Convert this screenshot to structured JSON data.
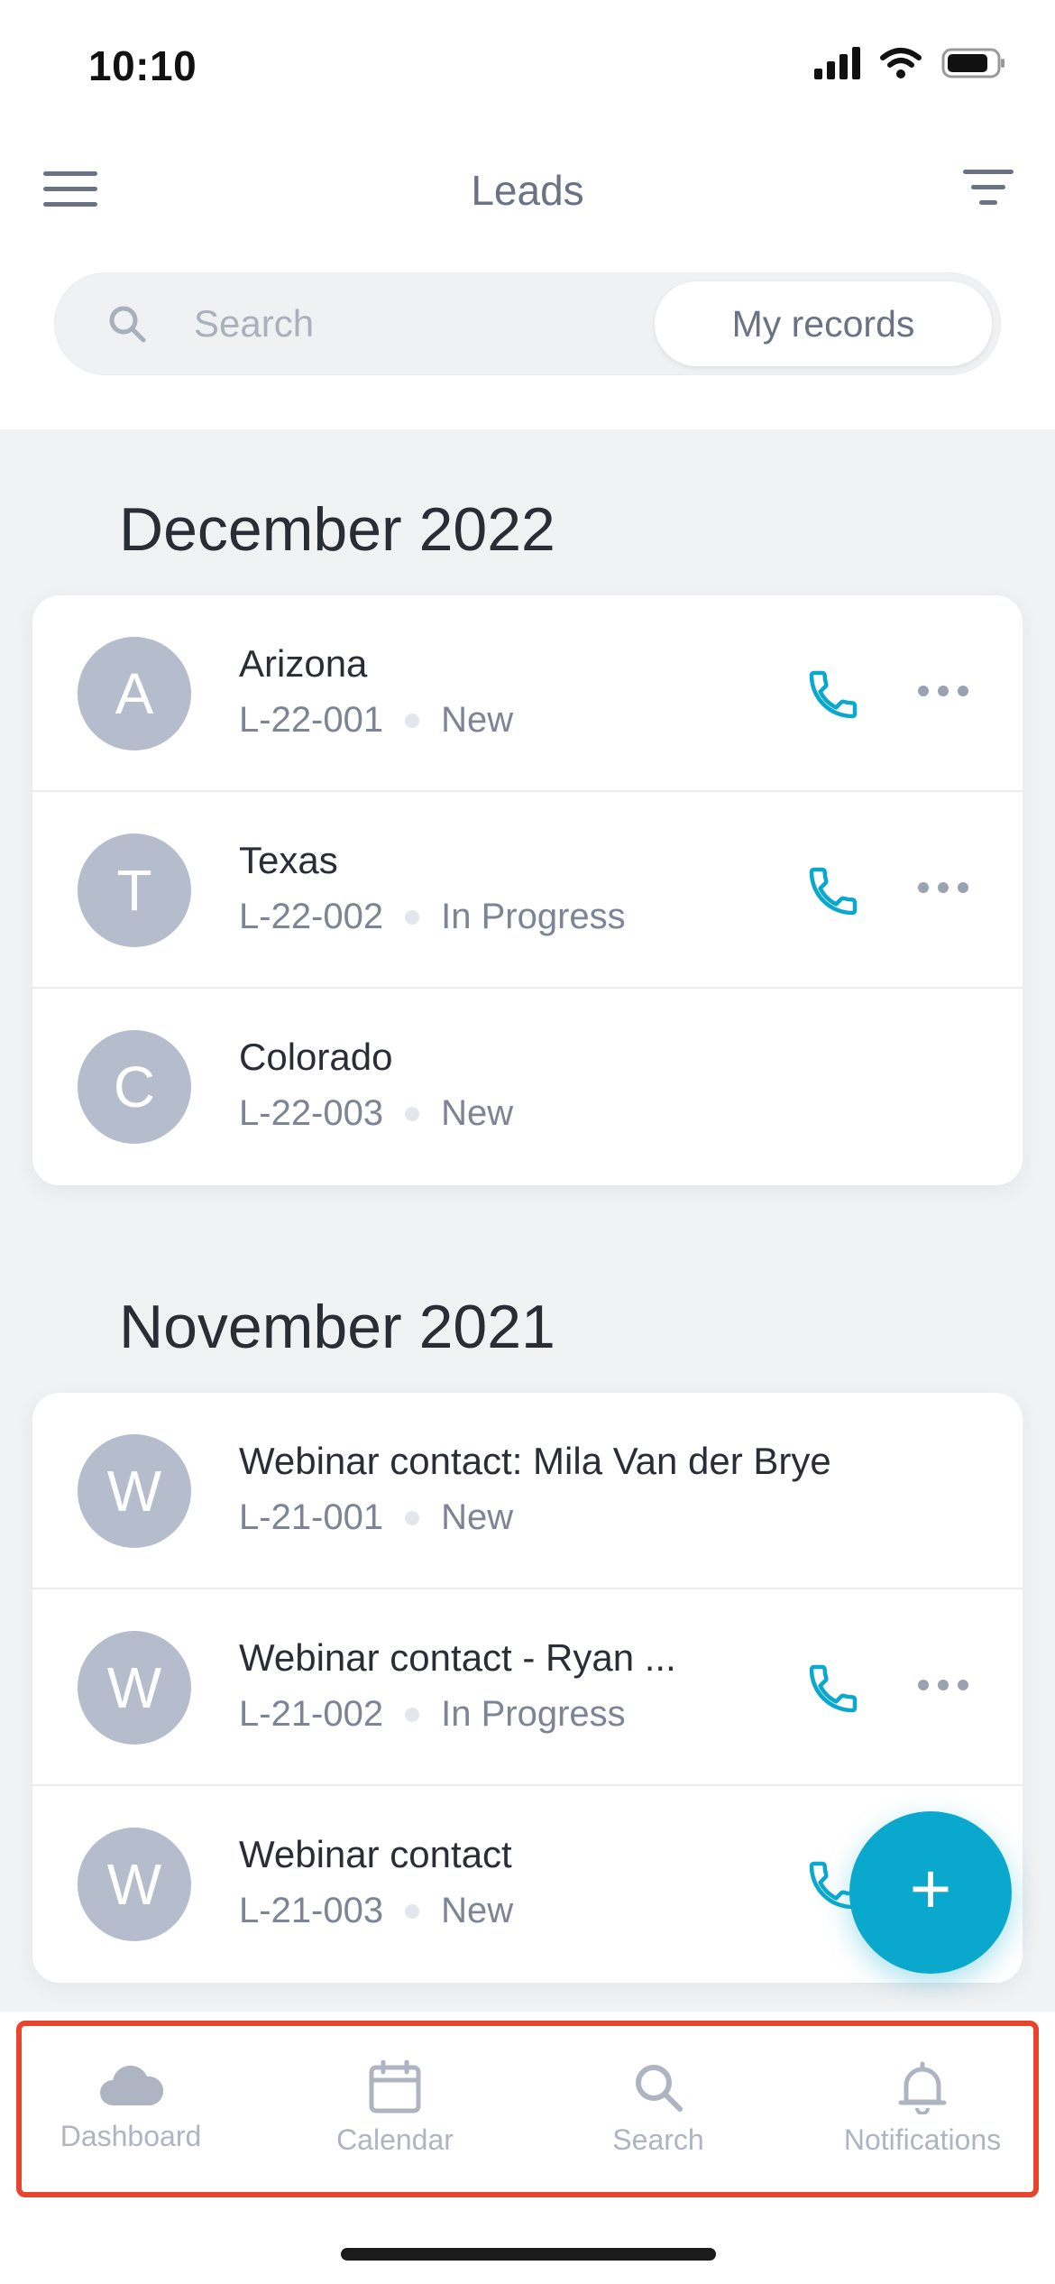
{
  "status_bar": {
    "time": "10:10"
  },
  "header": {
    "title": "Leads"
  },
  "search": {
    "placeholder": "Search",
    "records_toggle": "My records"
  },
  "sections": [
    {
      "title": "December 2022",
      "rows": [
        {
          "initial": "A",
          "name": "Arizona",
          "code": "L-22-001",
          "status": "New"
        },
        {
          "initial": "T",
          "name": "Texas",
          "code": "L-22-002",
          "status": "In Progress"
        },
        {
          "initial": "C",
          "name": "Colorado",
          "code": "L-22-003",
          "status": "New"
        }
      ]
    },
    {
      "title": "November 2021",
      "rows": [
        {
          "initial": "W",
          "name": "Webinar contact: Mila Van der Brye",
          "code": "L-21-001",
          "status": "New"
        },
        {
          "initial": "W",
          "name": "Webinar contact - Ryan ...",
          "code": "L-21-002",
          "status": "In Progress"
        },
        {
          "initial": "W",
          "name": "Webinar contact",
          "code": "L-21-003",
          "status": "New"
        }
      ]
    }
  ],
  "fab": {
    "label": "+"
  },
  "tabs": [
    {
      "label": "Dashboard",
      "icon": "cloud-icon"
    },
    {
      "label": "Calendar",
      "icon": "calendar-icon"
    },
    {
      "label": "Search",
      "icon": "search-icon"
    },
    {
      "label": "Notifications",
      "icon": "bell-icon"
    }
  ],
  "colors": {
    "accent": "#0aa8cc",
    "avatar": "#b5bccb",
    "highlight_frame": "#e8452e"
  }
}
